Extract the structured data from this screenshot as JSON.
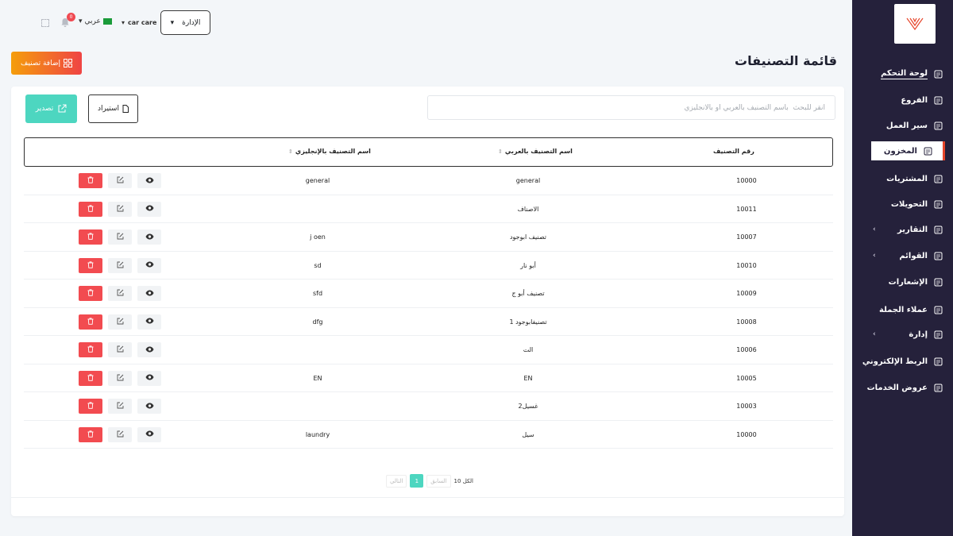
{
  "header": {
    "admin_label": "الإدارة",
    "company": "car care",
    "language": "عربي",
    "notifications_count": "0"
  },
  "page": {
    "title": "قائمة التصنيفات",
    "add_button": "إضافة تصنيف",
    "export_button": "تصدير",
    "import_button": "استيراد",
    "search_placeholder": "أنقر للبحث  باسم التصنيف بالعربي أو بالانجليزي"
  },
  "sidebar": {
    "items": [
      {
        "label": "لوحة التحكم",
        "icon": "dashboard-icon"
      },
      {
        "label": "الفروع",
        "icon": "branches-icon"
      },
      {
        "label": "سير العمل",
        "icon": "workflow-icon"
      },
      {
        "label": "المخزون",
        "icon": "warehouse-icon"
      },
      {
        "label": "المشتريات",
        "icon": "purchases-icon"
      },
      {
        "label": "التحويلات",
        "icon": "transfers-icon"
      },
      {
        "label": "التقارير",
        "icon": "reports-icon"
      },
      {
        "label": "القوائم",
        "icon": "lists-icon"
      },
      {
        "label": "الإشعارات",
        "icon": "bell-icon"
      },
      {
        "label": "عملاء الجملة",
        "icon": "customers-icon"
      },
      {
        "label": "إدارة",
        "icon": "admin-icon"
      },
      {
        "label": "الربط الإلكتروني",
        "icon": "link-icon"
      },
      {
        "label": "عروض الخدمات",
        "icon": "services-icon"
      }
    ]
  },
  "table": {
    "columns": {
      "id": "رقم التصنيف",
      "name_ar": "اسم التصنيف بالعربي",
      "name_en": "اسم التصنيف بالإنجليزي"
    },
    "rows": [
      {
        "id": "10000",
        "name_ar": "general",
        "name_en": "general"
      },
      {
        "id": "10011",
        "name_ar": "الاصناف",
        "name_en": ""
      },
      {
        "id": "10007",
        "name_ar": "تصنيف ابوجود",
        "name_en": "j oen"
      },
      {
        "id": "10010",
        "name_ar": "أبو نار",
        "name_en": "sd"
      },
      {
        "id": "10009",
        "name_ar": "تصنيف أبو ج",
        "name_en": "sfd"
      },
      {
        "id": "10008",
        "name_ar": "تصنيفابوجود 1",
        "name_en": "dfg"
      },
      {
        "id": "10006",
        "name_ar": "الت",
        "name_en": ""
      },
      {
        "id": "10005",
        "name_ar": "EN",
        "name_en": "EN"
      },
      {
        "id": "10003",
        "name_ar": "غسيل2",
        "name_en": ""
      },
      {
        "id": "10000",
        "name_ar": "سيل",
        "name_en": "laundry"
      }
    ]
  },
  "pagination": {
    "total_label": "الكل 10",
    "prev_label": "السابق",
    "current_page": "1",
    "next_label": "التالي"
  },
  "colors": {
    "sidebar_bg": "#25213b",
    "accent_teal": "#4dd6c0",
    "delete_red": "#f24b50",
    "active_border": "#e6452a"
  }
}
